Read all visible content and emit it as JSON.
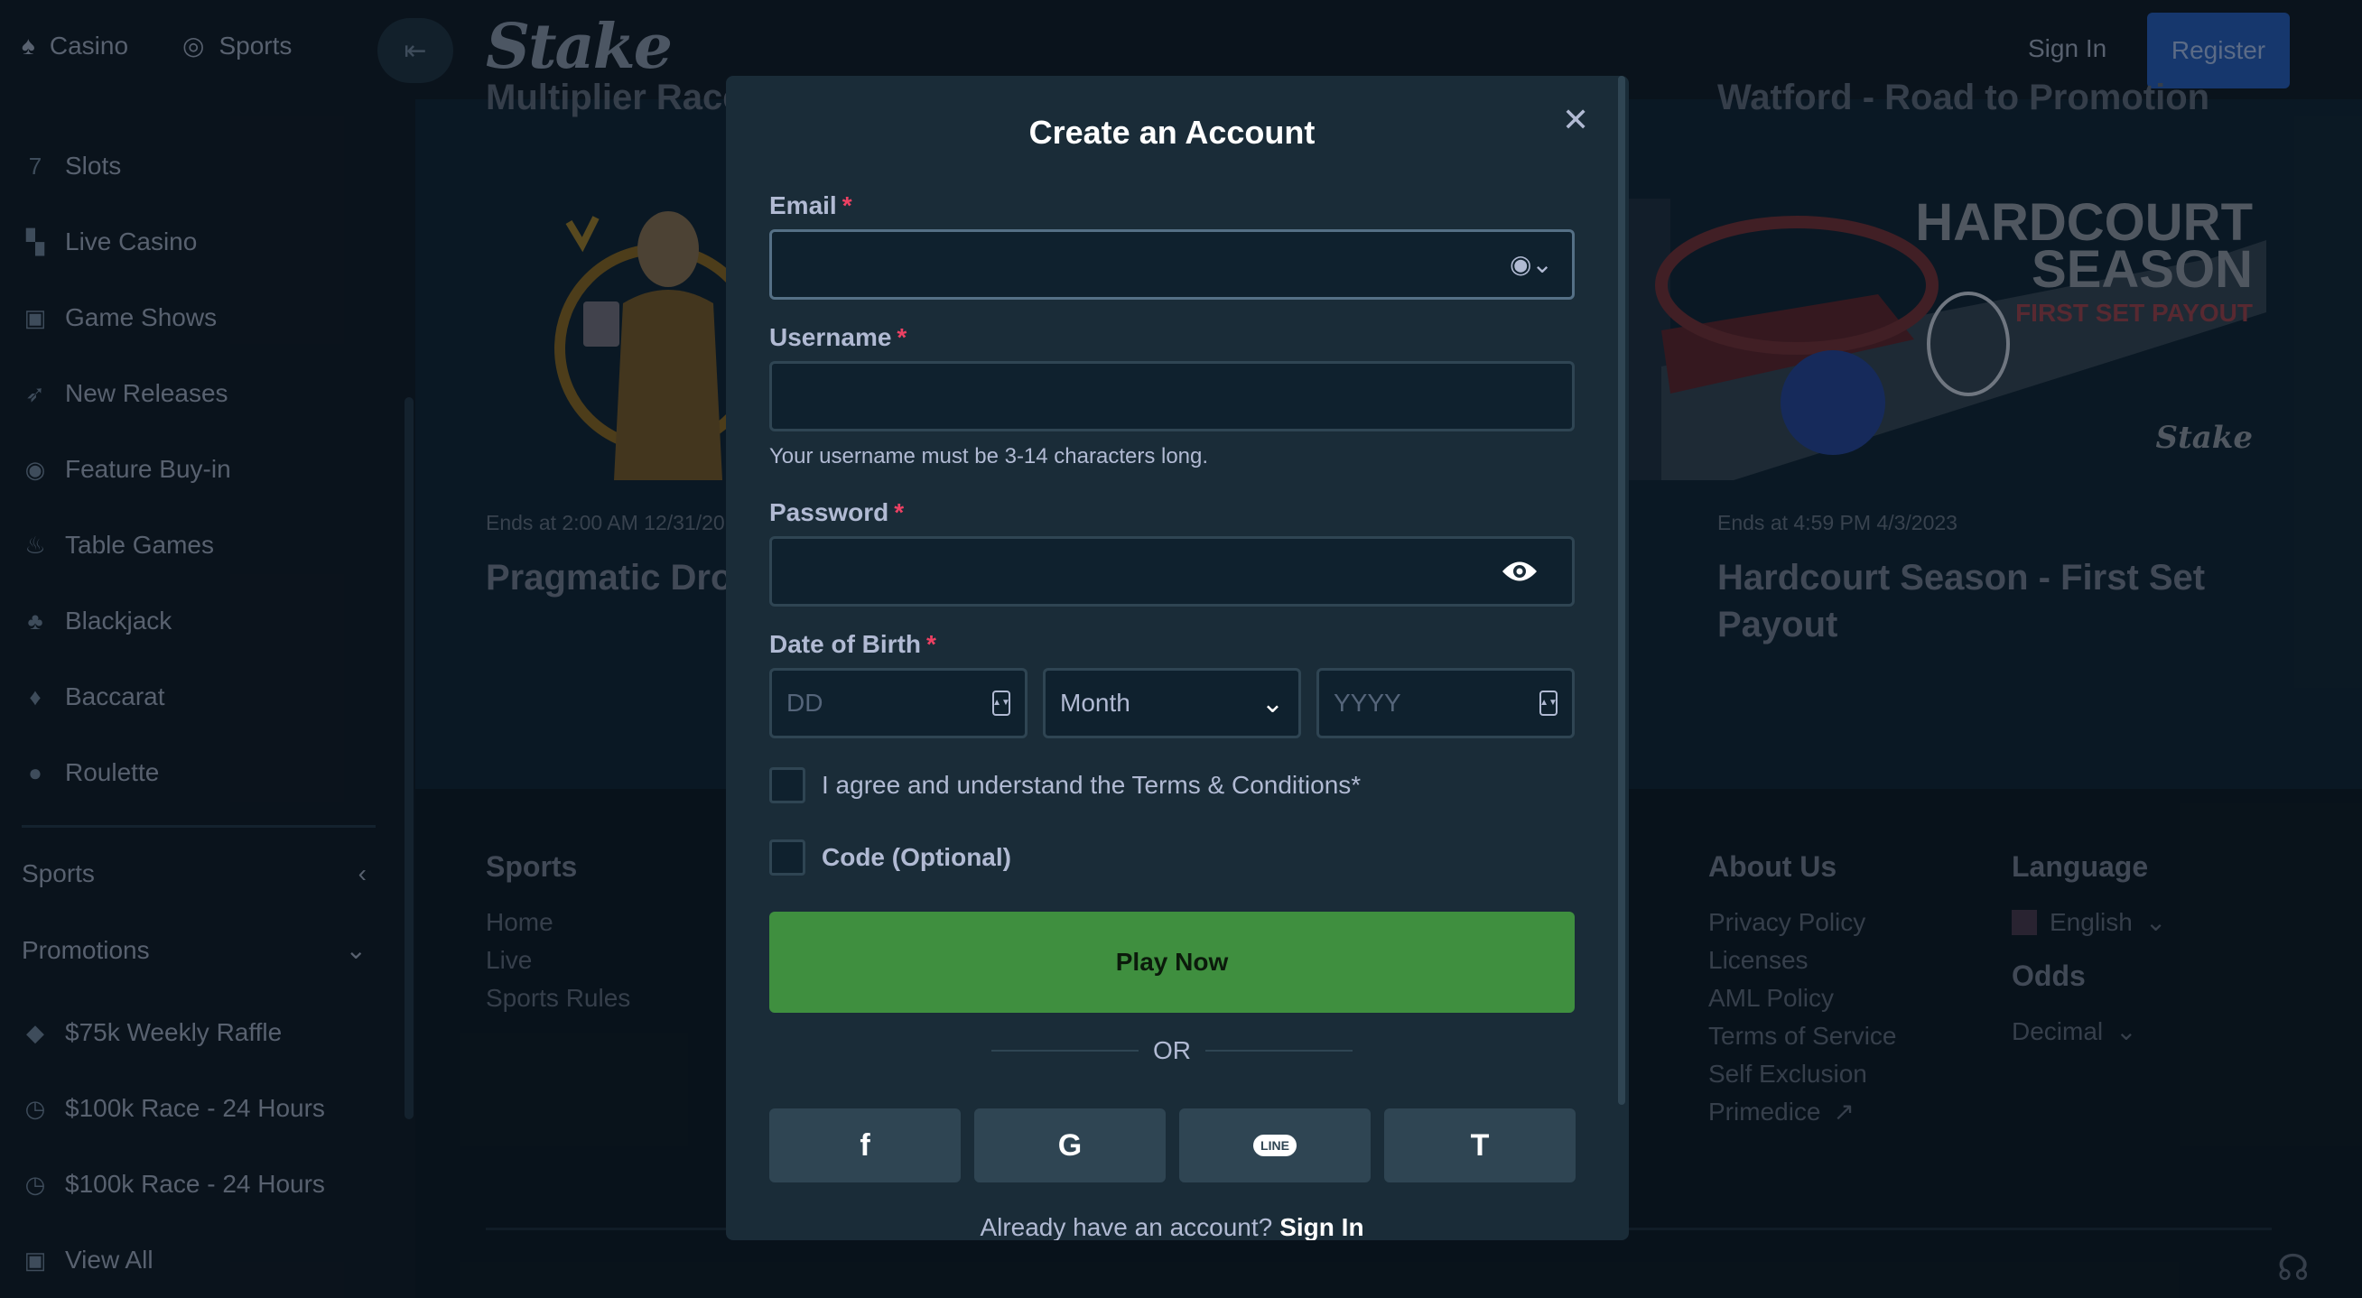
{
  "sidebar": {
    "top_tabs": [
      {
        "label": "Casino",
        "icon": "casino-chip-icon"
      },
      {
        "label": "Sports",
        "icon": "basketball-icon"
      }
    ],
    "items": [
      {
        "label": "Slots",
        "icon": "slots-icon"
      },
      {
        "label": "Live Casino",
        "icon": "live-casino-icon"
      },
      {
        "label": "Game Shows",
        "icon": "gift-icon"
      },
      {
        "label": "New Releases",
        "icon": "rocket-icon"
      },
      {
        "label": "Feature Buy-in",
        "icon": "feature-buyin-icon"
      },
      {
        "label": "Table Games",
        "icon": "flame-icon"
      },
      {
        "label": "Blackjack",
        "icon": "cards-icon"
      },
      {
        "label": "Baccarat",
        "icon": "baccarat-icon"
      },
      {
        "label": "Roulette",
        "icon": "roulette-icon"
      }
    ],
    "groups": [
      {
        "label": "Sports",
        "chevron": "chevron-left-icon"
      },
      {
        "label": "Promotions",
        "chevron": "chevron-down-icon"
      }
    ],
    "promos": [
      {
        "label": "$75k Weekly Raffle",
        "icon": "ticket-icon"
      },
      {
        "label": "$100k Race - 24 Hours",
        "icon": "race-icon"
      },
      {
        "label": "$100k Race - 24 Hours",
        "icon": "race-icon"
      },
      {
        "label": "View All",
        "icon": "gift-icon"
      }
    ]
  },
  "header": {
    "logo": "Stake",
    "sign_in": "Sign In",
    "register": "Register"
  },
  "promos": [
    {
      "head": "Multiplier Race",
      "ends": "Ends at 2:00 AM 12/31/20",
      "title": "Pragmatic Drop"
    },
    {
      "head": "Watford - Road to Promotion",
      "ends": "Ends at 4:59 PM 4/3/2023",
      "title_line1": "Hardcourt Season - First Set",
      "title_line2": "Payout"
    }
  ],
  "promo_banner_text": [
    "HARDCOURT",
    "SEASON",
    "FIRST SET PAYOUT",
    "Stake"
  ],
  "footer": {
    "sports": {
      "heading": "Sports",
      "links": [
        "Home",
        "Live",
        "Sports Rules"
      ]
    },
    "about": {
      "heading": "About Us",
      "links": [
        "Privacy Policy",
        "Licenses",
        "AML Policy",
        "Terms of Service",
        "Self Exclusion",
        "Primedice"
      ]
    },
    "language": {
      "heading": "Language",
      "value": "English",
      "odds_heading": "Odds",
      "odds_value": "Decimal"
    }
  },
  "modal": {
    "title": "Create an Account",
    "email": {
      "label": "Email",
      "required": "*",
      "value": ""
    },
    "username": {
      "label": "Username",
      "required": "*",
      "value": "",
      "hint": "Your username must be 3-14 characters long."
    },
    "password": {
      "label": "Password",
      "required": "*",
      "value": ""
    },
    "dob": {
      "label": "Date of Birth",
      "required": "*",
      "day_placeholder": "DD",
      "month_value": "Month",
      "year_placeholder": "YYYY"
    },
    "terms_label": "I agree and understand the Terms & Conditions*",
    "code_label": "Code (Optional)",
    "play_button": "Play Now",
    "or_text": "OR",
    "social": [
      {
        "name": "facebook",
        "glyph": "f"
      },
      {
        "name": "google",
        "glyph": "G"
      },
      {
        "name": "line",
        "glyph": "LINE"
      },
      {
        "name": "twitch",
        "glyph": "T"
      }
    ],
    "already_text": "Already have an account?",
    "sign_in_link": "Sign In"
  },
  "colors": {
    "background": "#0f212e",
    "modal": "#1a2c38",
    "input": "#0f212e",
    "border": "#2f4553",
    "play_button": "#3f8f3f",
    "register_button": "#1f4c93",
    "required": "#ed4163"
  }
}
